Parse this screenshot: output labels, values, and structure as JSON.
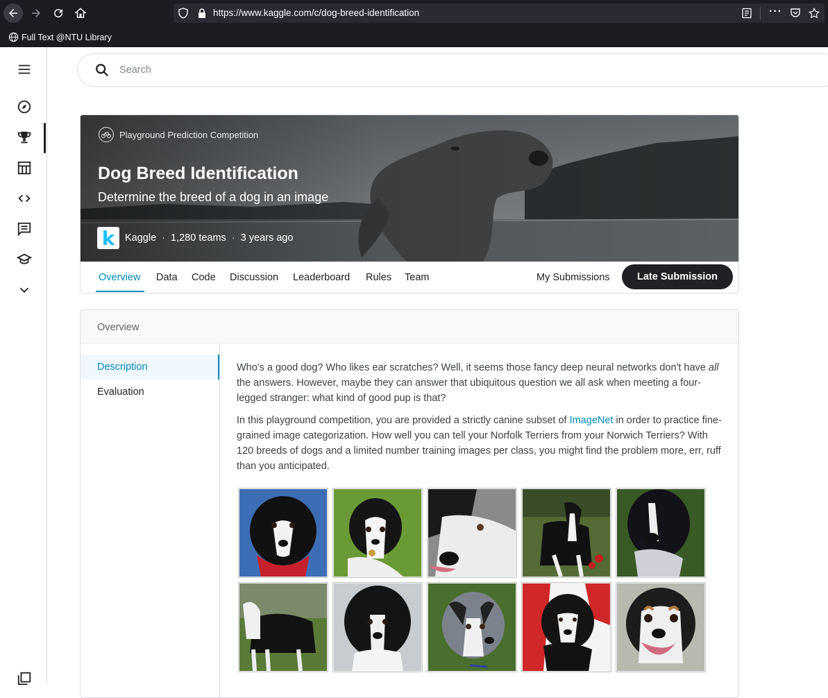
{
  "browser": {
    "url": "https://www.kaggle.com/c/dog-breed-identification",
    "bookmark_label": "Full Text @NTU Library"
  },
  "search": {
    "placeholder": "Search"
  },
  "rail": {
    "icons": [
      "menu-icon",
      "compass-icon",
      "trophy-icon",
      "table-icon",
      "code-icon",
      "comment-icon",
      "school-icon",
      "expand-more-icon"
    ]
  },
  "competition": {
    "type_label": "Playground Prediction Competition",
    "title": "Dog Breed Identification",
    "subtitle": "Determine the breed of a dog in an image",
    "host": "Kaggle",
    "teams": "1,280 teams",
    "age": "3 years ago",
    "host_logo_letter": "k"
  },
  "tabs": {
    "items": [
      "Overview",
      "Data",
      "Code",
      "Discussion",
      "Leaderboard",
      "Rules",
      "Team"
    ],
    "active": "Overview",
    "my_submissions": "My Submissions",
    "late_submission": "Late Submission"
  },
  "overview": {
    "header": "Overview",
    "side_items": [
      "Description",
      "Evaluation"
    ],
    "para1_a": "Who's a good dog? Who likes ear scratches? Well, it seems those fancy deep neural networks don't have ",
    "para1_em": "all",
    "para1_b": " the answers. However, maybe they can answer that ubiquitous question we all ask when meeting a four-legged stranger: what kind of good pup is that?",
    "para2_a": "In this playground competition, you are provided a strictly canine subset of ",
    "para2_link": "ImageNet",
    "para2_b": " in order to practice fine-grained image categorization. How well you can tell your Norfolk Terriers from your Norwich Terriers? With 120 breeds of dogs and a limited number training images per class, you might find the problem more, err, ruff than you anticipated."
  },
  "colors": {
    "accent": "#008abc",
    "dark": "#202124",
    "hero_bg": "#5a5d60"
  }
}
